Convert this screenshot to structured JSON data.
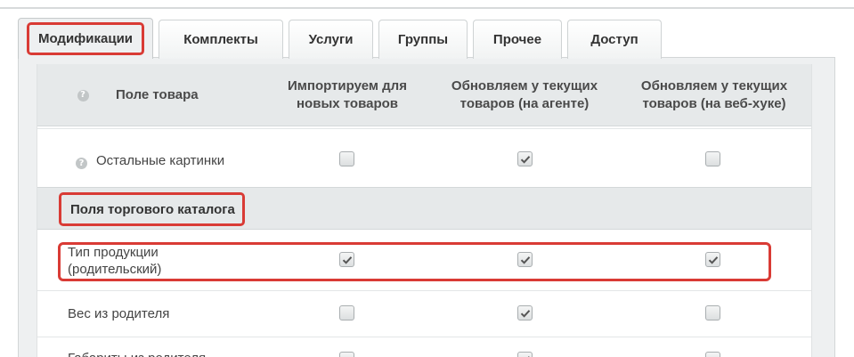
{
  "tabs": [
    {
      "label": "Модификации",
      "active": true
    },
    {
      "label": "Комплекты",
      "active": false
    },
    {
      "label": "Услуги",
      "active": false
    },
    {
      "label": "Группы",
      "active": false
    },
    {
      "label": "Прочее",
      "active": false
    },
    {
      "label": "Доступ",
      "active": false
    }
  ],
  "table": {
    "help_glyph": "?",
    "columns": [
      "Поле товара",
      "Импортируем для новых товаров",
      "Обновляем у текущих товаров (на агенте)",
      "Обновляем у текущих товаров (на веб-хуке)"
    ],
    "section_title": "Поля торгового каталога",
    "rows": [
      {
        "label": "Остальные картинки",
        "checks": [
          false,
          true,
          false
        ]
      },
      {
        "label": "Тип продукции (родительский)",
        "checks": [
          true,
          true,
          true
        ]
      },
      {
        "label": "Вес из родителя",
        "checks": [
          false,
          true,
          false
        ]
      },
      {
        "label": "Габариты из родителя",
        "checks": [
          false,
          true,
          false
        ]
      }
    ]
  },
  "colors": {
    "highlight": "#d93b35",
    "header_bg": "#e6e9ea"
  }
}
